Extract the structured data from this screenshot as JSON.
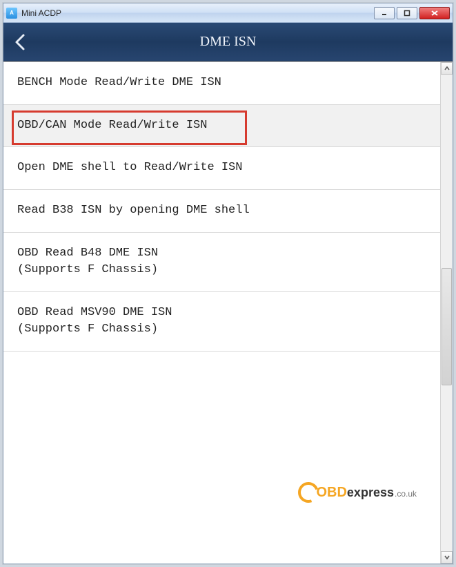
{
  "window": {
    "title": "Mini ACDP"
  },
  "nav": {
    "title": "DME ISN"
  },
  "menu": {
    "items": [
      {
        "label": "BENCH Mode Read/Write DME ISN",
        "selected": false
      },
      {
        "label": "OBD/CAN Mode Read/Write ISN",
        "selected": true
      },
      {
        "label": "Open DME shell to Read/Write ISN",
        "selected": false
      },
      {
        "label": "Read B38 ISN by opening DME shell",
        "selected": false
      },
      {
        "label": "OBD Read B48 DME ISN\n(Supports F Chassis)",
        "selected": false
      },
      {
        "label": "OBD Read MSV90 DME ISN\n(Supports F Chassis)",
        "selected": false
      }
    ]
  },
  "watermark": {
    "bold": "OBD",
    "rest": "express",
    "suffix": ".co.uk"
  }
}
